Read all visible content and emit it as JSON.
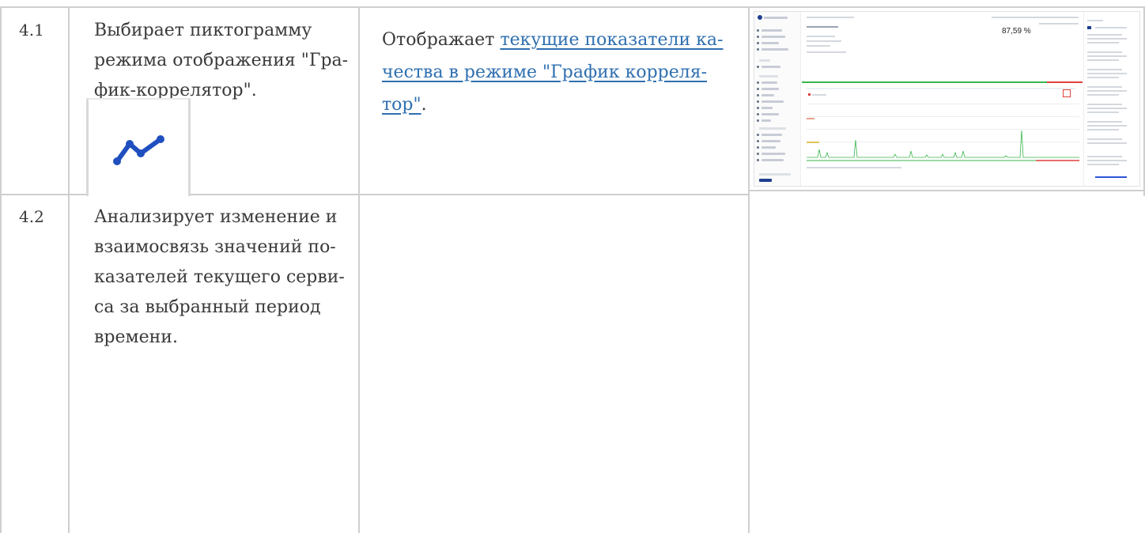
{
  "rows": [
    {
      "num": "4.1",
      "action": "Выбирает пиктограмму режима отображения \"График-коррелятор\".",
      "action_lines": [
        "Выбирает пиктограмму",
        "режима отображения \"Гра-",
        "фик-коррелятор\"."
      ],
      "response_prefix": "Отображает ",
      "response_link_lines": [
        "текущие показатели ка-",
        "чества в режиме \"График корреля-",
        "тор\""
      ],
      "response_suffix": ".",
      "icon": "line-chart-icon",
      "icon_color": "#1f4fbf"
    },
    {
      "num": "4.2",
      "action_lines": [
        "Анализирует изменение и",
        "взаимосвязь значений по-",
        "казателей текущего серви-",
        "са за выбранный период",
        "времени."
      ]
    }
  ],
  "screenshot": {
    "percent": "87,59 %"
  },
  "colors": {
    "border": "#cfcfcf",
    "link": "#2e6fb0",
    "text": "#3a3a3a"
  }
}
